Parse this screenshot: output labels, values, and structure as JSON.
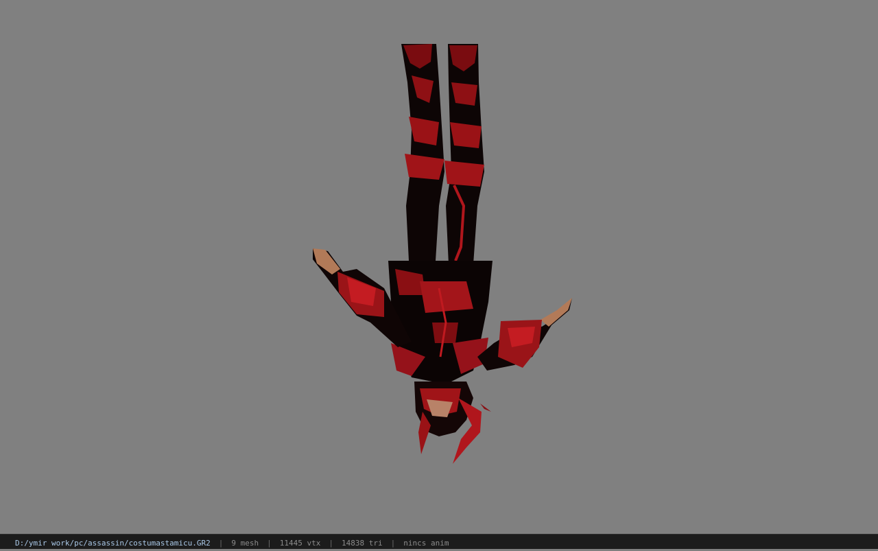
{
  "viewer": {
    "background_color": "#808080",
    "model_icon": "upside-down-armored-character-model"
  },
  "status": {
    "file_path": "D:/ymir work/pc/assassin/costumastamicu.GR2",
    "separator": "|",
    "mesh_count": "9 mesh",
    "vertex_count": "11445 vtx",
    "triangle_count": "14838 tri",
    "anim_status": "nincs anim"
  }
}
